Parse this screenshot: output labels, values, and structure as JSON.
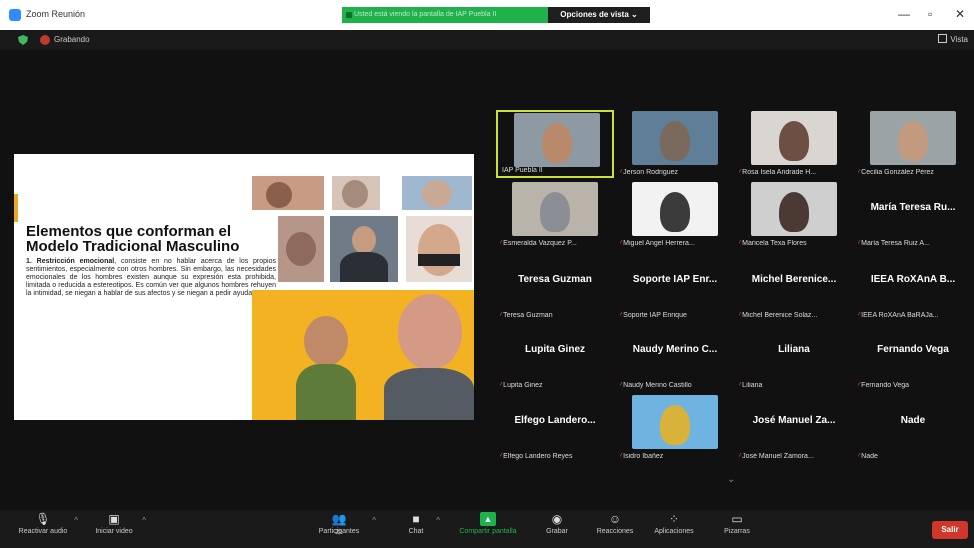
{
  "window": {
    "title": "Zoom Reunión",
    "share_banner": "Usted está viendo la pantalla de IAP Puebla II",
    "view_options": "Opciones de vista ⌄",
    "minimize": "—",
    "maximize": "▫",
    "close": "✕"
  },
  "topbar": {
    "recording_label": "Grabando",
    "view_label": "Vista"
  },
  "slide": {
    "title": "Elementos que conforman el Modelo Tradicional Masculino",
    "body_heading": "1. Restricción emocional",
    "body_text": ", consiste en no hablar acerca de los propios sentimientos, especialmente con otros hombres. Sin embargo, las necesidades emocionales de los hombres existen aunque su expresión esta prohibida, limitada o reducida a estereotipos. Es común ver que algunos hombres rehuyen la intimidad, se niegan a hablar de sus afectos y se niegan a pedir ayuda."
  },
  "participants": [
    {
      "name": "IAP Puebla II",
      "display": "",
      "video": true,
      "active": true,
      "muted": false,
      "bg": "#8d9aa3",
      "skin": "#b88a6b"
    },
    {
      "name": "Jerson Rodriguez",
      "display": "",
      "video": true,
      "active": false,
      "muted": true,
      "bg": "#5f7e98",
      "skin": "#7a6a5e"
    },
    {
      "name": "Rosa Isela Andrade H...",
      "display": "",
      "video": true,
      "active": false,
      "muted": true,
      "bg": "#d9d6d2",
      "skin": "#6d4f43"
    },
    {
      "name": "Cecilia González Pérez",
      "display": "",
      "video": true,
      "active": false,
      "muted": true,
      "bg": "#9aa3a6",
      "skin": "#c29a80"
    },
    {
      "name": "Esmeralda Vazquez P...",
      "display": "",
      "video": true,
      "active": false,
      "muted": true,
      "bg": "#b9b3aa",
      "skin": "#8c8e96"
    },
    {
      "name": "Miguel Angel Herrera...",
      "display": "",
      "video": true,
      "active": false,
      "muted": true,
      "bg": "#f2f2f2",
      "skin": "#3b3b3b"
    },
    {
      "name": "Maricela Texa Flores",
      "display": "",
      "video": true,
      "active": false,
      "muted": true,
      "bg": "#cfcfcf",
      "skin": "#4a3a33"
    },
    {
      "name": "María Teresa Ruiz A...",
      "display": "María Teresa Ru...",
      "video": false,
      "active": false,
      "muted": true
    },
    {
      "name": "Teresa Guzman",
      "display": "Teresa Guzman",
      "video": false,
      "active": false,
      "muted": true
    },
    {
      "name": "Soporte IAP Enrique",
      "display": "Soporte IAP Enr...",
      "video": false,
      "active": false,
      "muted": true
    },
    {
      "name": "Michel Berenice Solaz...",
      "display": "Michel Berenice...",
      "video": false,
      "active": false,
      "muted": true
    },
    {
      "name": "IEEA RoXAnA BaRAJa...",
      "display": "IEEA RoXAnA B...",
      "video": false,
      "active": false,
      "muted": true
    },
    {
      "name": "Lupita Ginez",
      "display": "Lupita Ginez",
      "video": false,
      "active": false,
      "muted": true
    },
    {
      "name": "Naudy Merino Castillo",
      "display": "Naudy Merino C...",
      "video": false,
      "active": false,
      "muted": true
    },
    {
      "name": "Liliana",
      "display": "Liliana",
      "video": false,
      "active": false,
      "muted": true
    },
    {
      "name": "Fernando Vega",
      "display": "Fernando Vega",
      "video": false,
      "active": false,
      "muted": true
    },
    {
      "name": "Elfego Landero Reyes",
      "display": "Elfego Landero...",
      "video": false,
      "active": false,
      "muted": true
    },
    {
      "name": "Isidro Ibañez",
      "display": "",
      "video": true,
      "active": false,
      "muted": true,
      "bg": "#6fb4e0",
      "skin": "#d9b23a"
    },
    {
      "name": "José Manuel Zamora...",
      "display": "José Manuel Za...",
      "video": false,
      "active": false,
      "muted": true
    },
    {
      "name": "Nade",
      "display": "Nade",
      "video": false,
      "active": false,
      "muted": true
    }
  ],
  "toolbar": {
    "audio": "Reactivar audio",
    "video": "Iniciar video",
    "participants": "Participantes",
    "participants_count": "21",
    "chat": "Chat",
    "share": "Compartir pantalla",
    "record": "Grabar",
    "reactions": "Reacciones",
    "apps": "Aplicaciones",
    "whiteboards": "Pizarras",
    "leave": "Salir"
  },
  "colors": {
    "accent_green": "#20b24a",
    "active_speaker": "#c8e23a",
    "muted_red": "#e0403a",
    "leave_red": "#d0372a"
  }
}
